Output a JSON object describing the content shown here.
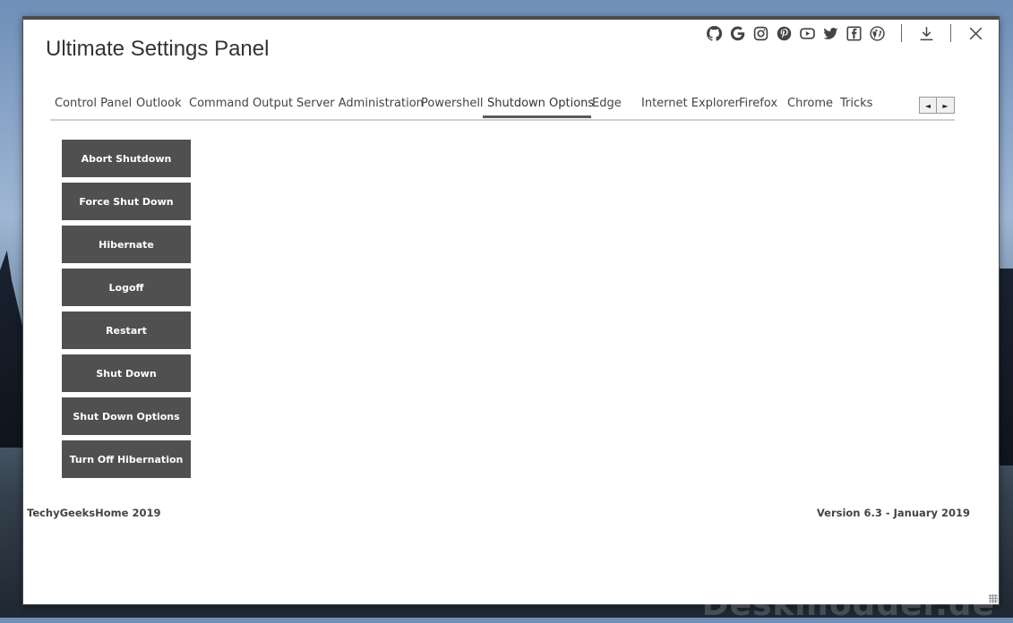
{
  "window": {
    "title": "Ultimate Settings Panel"
  },
  "toolbar": {
    "icons": [
      "github-icon",
      "google-icon",
      "instagram-icon",
      "pinterest-icon",
      "youtube-icon",
      "twitter-icon",
      "facebook-icon",
      "wordpress-icon",
      "download-icon",
      "close-icon"
    ]
  },
  "tabs": [
    {
      "label": "Control Panel"
    },
    {
      "label": "Outlook"
    },
    {
      "label": "Command Output"
    },
    {
      "label": "Server Administration"
    },
    {
      "label": "Powershell"
    },
    {
      "label": "Shutdown Options"
    },
    {
      "label": "Edge"
    },
    {
      "label": "Internet Explorer"
    },
    {
      "label": "Firefox"
    },
    {
      "label": "Chrome"
    },
    {
      "label": "Tricks"
    }
  ],
  "active_tab": "Shutdown Options",
  "tab_scroll": {
    "left": "◄",
    "right": "►"
  },
  "buttons": [
    {
      "label": "Abort Shutdown"
    },
    {
      "label": "Force Shut Down"
    },
    {
      "label": "Hibernate"
    },
    {
      "label": "Logoff"
    },
    {
      "label": "Restart"
    },
    {
      "label": "Shut Down"
    },
    {
      "label": "Shut Down Options"
    },
    {
      "label": "Turn Off Hibernation"
    }
  ],
  "footer": {
    "left": "TechyGeeksHome 2019",
    "right": "Version 6.3 - January 2019"
  },
  "watermark": "Deskmodder.de",
  "colors": {
    "button_bg": "#505050",
    "button_text": "#ffffff",
    "active_tab_underline": "#5a5a5a"
  }
}
